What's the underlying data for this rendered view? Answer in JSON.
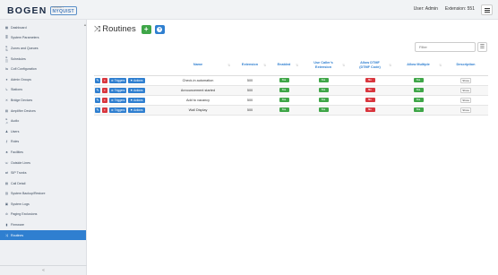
{
  "header": {
    "logo_main": "BOGEN",
    "logo_small": "PRODUCT",
    "logo_sub": "NYQUIST",
    "user_label": "User: Admin",
    "extension_label": "Extension: 551"
  },
  "sidebar": {
    "items": [
      {
        "label": "Dashboard",
        "icon": "▦"
      },
      {
        "label": "System Parameters",
        "icon": "≣"
      },
      {
        "label": "Zones and Queues",
        "icon": "▸ ⇅"
      },
      {
        "label": "Schedules",
        "icon": "▸ ◫"
      },
      {
        "label": "Cofl Configuration",
        "icon": "⇋"
      },
      {
        "label": "Admin Groups",
        "icon": "●"
      },
      {
        "label": "Stations",
        "icon": "↳"
      },
      {
        "label": "Bridge Devices",
        "icon": "✕"
      },
      {
        "label": "Amplifier Devices",
        "icon": "▤"
      },
      {
        "label": "Audio",
        "icon": "▸ ♫"
      },
      {
        "label": "Users",
        "icon": "♟"
      },
      {
        "label": "Roles",
        "icon": "⚷"
      },
      {
        "label": "Facilities",
        "icon": "♣"
      },
      {
        "label": "Outside Lines",
        "icon": "☏"
      },
      {
        "label": "SIP Trunks",
        "icon": "⇄"
      },
      {
        "label": "Call Detail",
        "icon": "▤"
      },
      {
        "label": "System Backup/Restore",
        "icon": "▥"
      },
      {
        "label": "System Logs",
        "icon": "▣"
      },
      {
        "label": "Paging Exclusions",
        "icon": "⊘"
      },
      {
        "label": "Firmware",
        "icon": "▮"
      },
      {
        "label": "Routines",
        "icon": "⤨",
        "active": true
      }
    ],
    "collapse_icon": "«"
  },
  "main": {
    "title": "Routines",
    "add_label": "+",
    "help_label": "?",
    "filter_placeholder": "Filter"
  },
  "table": {
    "columns": [
      "Name",
      "Extension",
      "Enabled",
      "Use Caller's Extension",
      "Allow DTMF (DTMF Code)",
      "Allow Multiple",
      "Description"
    ],
    "triggers_label": "Triggers",
    "actions_label": "Actions",
    "yes_label": "Yes",
    "no_label": "No",
    "show_label": "Show",
    "rows": [
      {
        "name": "Check-in automation",
        "extension": "500",
        "enabled": "Yes",
        "use_caller": "Yes",
        "allow_dtmf": "No",
        "allow_multiple": "Yes",
        "description": "Show"
      },
      {
        "name": "Announcement started",
        "extension": "500",
        "enabled": "Yes",
        "use_caller": "Yes",
        "allow_dtmf": "No",
        "allow_multiple": "Yes",
        "description": "Show"
      },
      {
        "name": "Add to vacancy",
        "extension": "500",
        "enabled": "Yes",
        "use_caller": "Yes",
        "allow_dtmf": "No",
        "allow_multiple": "Yes",
        "description": "Show"
      },
      {
        "name": "Wall Display",
        "extension": "500",
        "enabled": "Yes",
        "use_caller": "Yes",
        "allow_dtmf": "No",
        "allow_multiple": "Yes",
        "description": "Show"
      }
    ]
  },
  "colors": {
    "accent": "#2f7fd0",
    "yes": "#3fa648",
    "no": "#d9363e",
    "sidebar_bg": "#eef0f3"
  }
}
